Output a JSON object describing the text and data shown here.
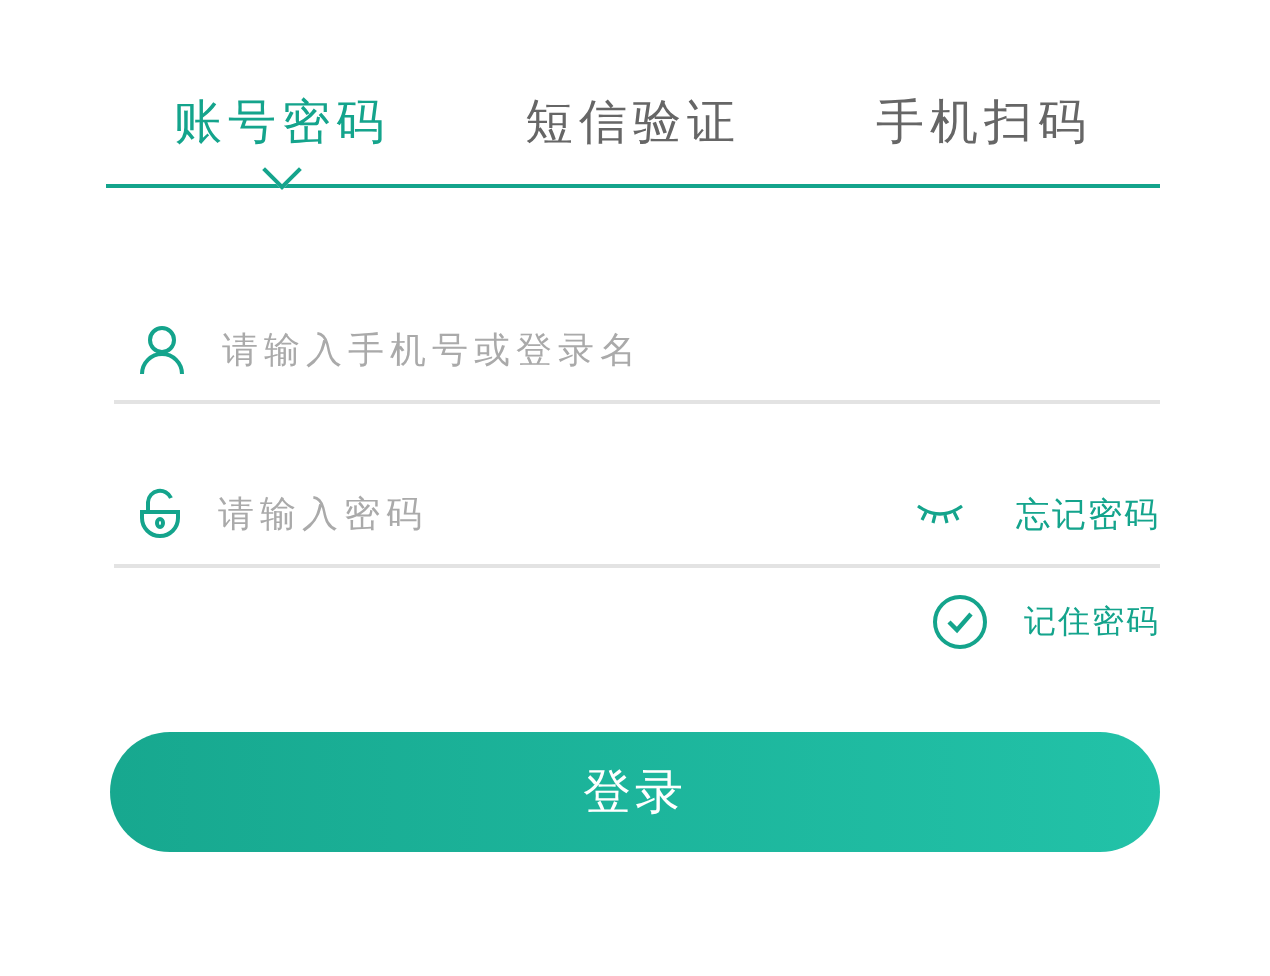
{
  "tabs": [
    {
      "label": "账号密码",
      "selected": true
    },
    {
      "label": "短信验证",
      "selected": false
    },
    {
      "label": "手机扫码",
      "selected": false
    }
  ],
  "fields": [
    {
      "kind": "account",
      "placeholder": "请输入手机号或登录名"
    },
    {
      "kind": "password",
      "placeholder": "请输入密码",
      "link": "忘记密码"
    }
  ],
  "remember": {
    "label": "记住密码",
    "checked": true
  },
  "submit": {
    "label": "登录"
  }
}
